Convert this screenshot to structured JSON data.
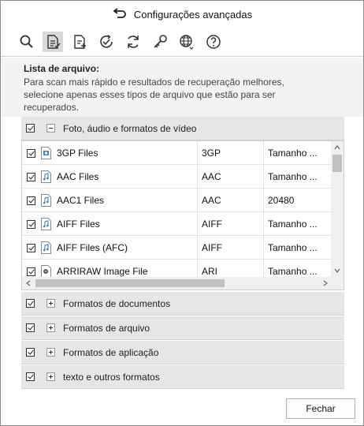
{
  "window": {
    "title": "Configurações avançadas",
    "back_icon": "undo-arrow-icon"
  },
  "toolbar": {
    "buttons": [
      {
        "icon": "search-icon"
      },
      {
        "icon": "file-list-settings-icon",
        "active": true
      },
      {
        "icon": "file-add-icon"
      },
      {
        "icon": "check-circle-icon"
      },
      {
        "icon": "refresh-icon"
      },
      {
        "icon": "key-icon"
      },
      {
        "icon": "globe-icon"
      },
      {
        "icon": "help-icon"
      }
    ]
  },
  "info": {
    "heading": "Lista de arquivo:",
    "description": "Para scan mais rápido e resultados de recuperação melhores, selecione apenas esses tipos de arquivo que estão para ser recuperados."
  },
  "groups": {
    "media": {
      "label": "Foto, áudio e formatos de vídeo",
      "checked": true,
      "expanded": true
    },
    "documents": {
      "label": "Formatos de documentos",
      "checked": true,
      "expanded": false
    },
    "archives": {
      "label": "Formatos de arquivo",
      "checked": true,
      "expanded": false
    },
    "applications": {
      "label": "Formatos de aplicação",
      "checked": true,
      "expanded": false
    },
    "text": {
      "label": "texto e outros formatos",
      "checked": true,
      "expanded": false
    }
  },
  "files": [
    {
      "name": "3GP Files",
      "ext": "3GP",
      "size": "Tamanho ...",
      "icon": "video-file-icon"
    },
    {
      "name": "AAC Files",
      "ext": "AAC",
      "size": "Tamanho ...",
      "icon": "audio-file-icon"
    },
    {
      "name": "AAC1 Files",
      "ext": "AAC",
      "size": "20480",
      "icon": "audio-file-icon"
    },
    {
      "name": "AIFF Files",
      "ext": "AIFF",
      "size": "Tamanho ...",
      "icon": "audio-file-icon"
    },
    {
      "name": "AIFF Files (AFC)",
      "ext": "AIFF",
      "size": "Tamanho ...",
      "icon": "audio-file-icon"
    },
    {
      "name": "ARRIRAW Image File",
      "ext": "ARI",
      "size": "Tamanho ...",
      "icon": "image-file-icon"
    }
  ],
  "footer": {
    "close_label": "Fechar"
  }
}
